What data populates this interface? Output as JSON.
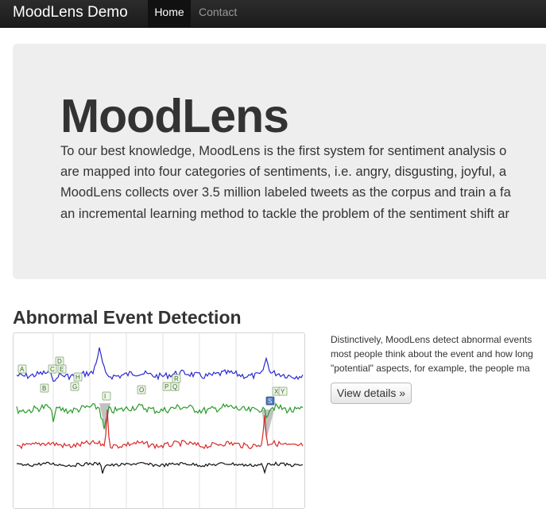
{
  "navbar": {
    "brand": "MoodLens Demo",
    "items": [
      {
        "label": "Home",
        "active": true
      },
      {
        "label": "Contact",
        "active": false
      }
    ],
    "colors": {
      "background": "#1b1b1b",
      "active_bg": "#111111",
      "brand": "#ffffff",
      "link": "#999999"
    }
  },
  "hero": {
    "title": "MoodLens",
    "lines": [
      "To our best knowledge, MoodLens is the first system for sentiment analysis o",
      "are mapped into four categories of sentiments, i.e. angry, disgusting, joyful, a",
      "MoodLens collects over 3.5 million labeled tweets as the corpus and train a fa",
      "an incremental learning method to tackle the problem of the sentiment shift ar"
    ],
    "background": "#eeeeee"
  },
  "section": {
    "title": "Abnormal Event Detection",
    "description_lines": [
      "Distinctively, MoodLens detect abnormal events",
      "most people think about the event and how long",
      "\"potential\" aspects, for example, the people ma"
    ],
    "button_label": "View details »",
    "thumbnail": {
      "series_colors": [
        "#2a2ad0",
        "#2a9a2a",
        "#d82a2a",
        "#111111"
      ],
      "markers": [
        "A",
        "B",
        "C",
        "D",
        "E",
        "H",
        "G",
        "I",
        "O",
        "P",
        "Q",
        "R",
        "S",
        "X",
        "Y"
      ]
    }
  }
}
